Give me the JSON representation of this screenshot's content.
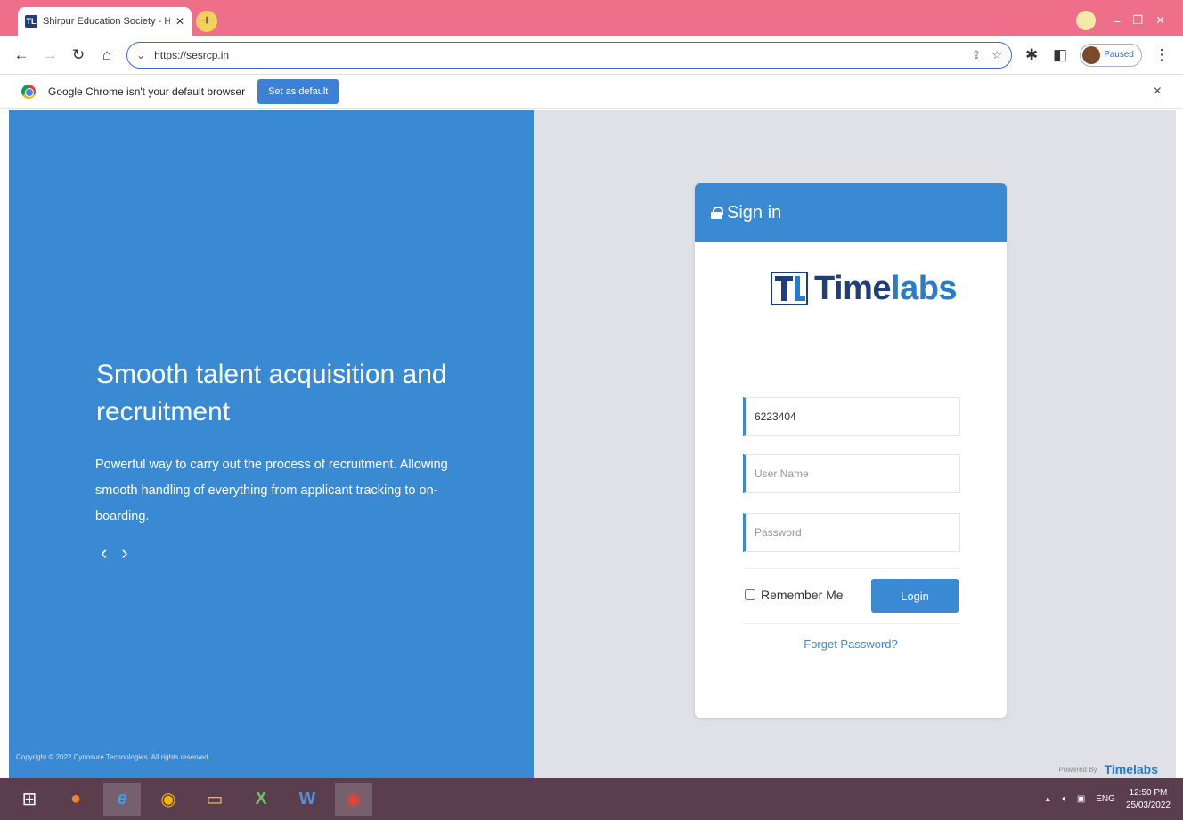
{
  "browser": {
    "tab_title": "Shirpur Education Society - HR F",
    "favicon_text": "TL",
    "new_tab": "+",
    "url": "https://sesrcp.in",
    "profile_status": "Paused",
    "window_controls": {
      "minimize": "–",
      "maximize": "❐",
      "close": "✕"
    }
  },
  "infobar": {
    "message": "Google Chrome isn't your default browser",
    "button": "Set as default",
    "close": "×"
  },
  "hero": {
    "headline": "Smooth talent acquisition and recruitment",
    "description": "Powerful way to carry out the process of recruitment. Allowing smooth handling of everything from applicant tracking to on-boarding.",
    "prev": "‹",
    "next": "›"
  },
  "signin": {
    "title": "Sign in",
    "logo_time": "Time",
    "logo_labs": "labs",
    "company_value": "6223404",
    "username_placeholder": "User Name",
    "password_placeholder": "Password",
    "remember_label": "Remember Me",
    "remember_checked": false,
    "login_label": "Login",
    "forgot_label": "Forget Password?"
  },
  "footer": {
    "copyright": "Copyright © 2022 Cynosure Technologies. All rights reserved.",
    "powered_by": "Powered By",
    "powered_brand": "Timelabs"
  },
  "taskbar": {
    "language": "ENG",
    "time": "12:50 PM",
    "date": "25/03/2022"
  },
  "colors": {
    "primary": "#3a8ad3",
    "tabstrip": "#ef6f8a",
    "taskbar": "#5a3e4e"
  }
}
